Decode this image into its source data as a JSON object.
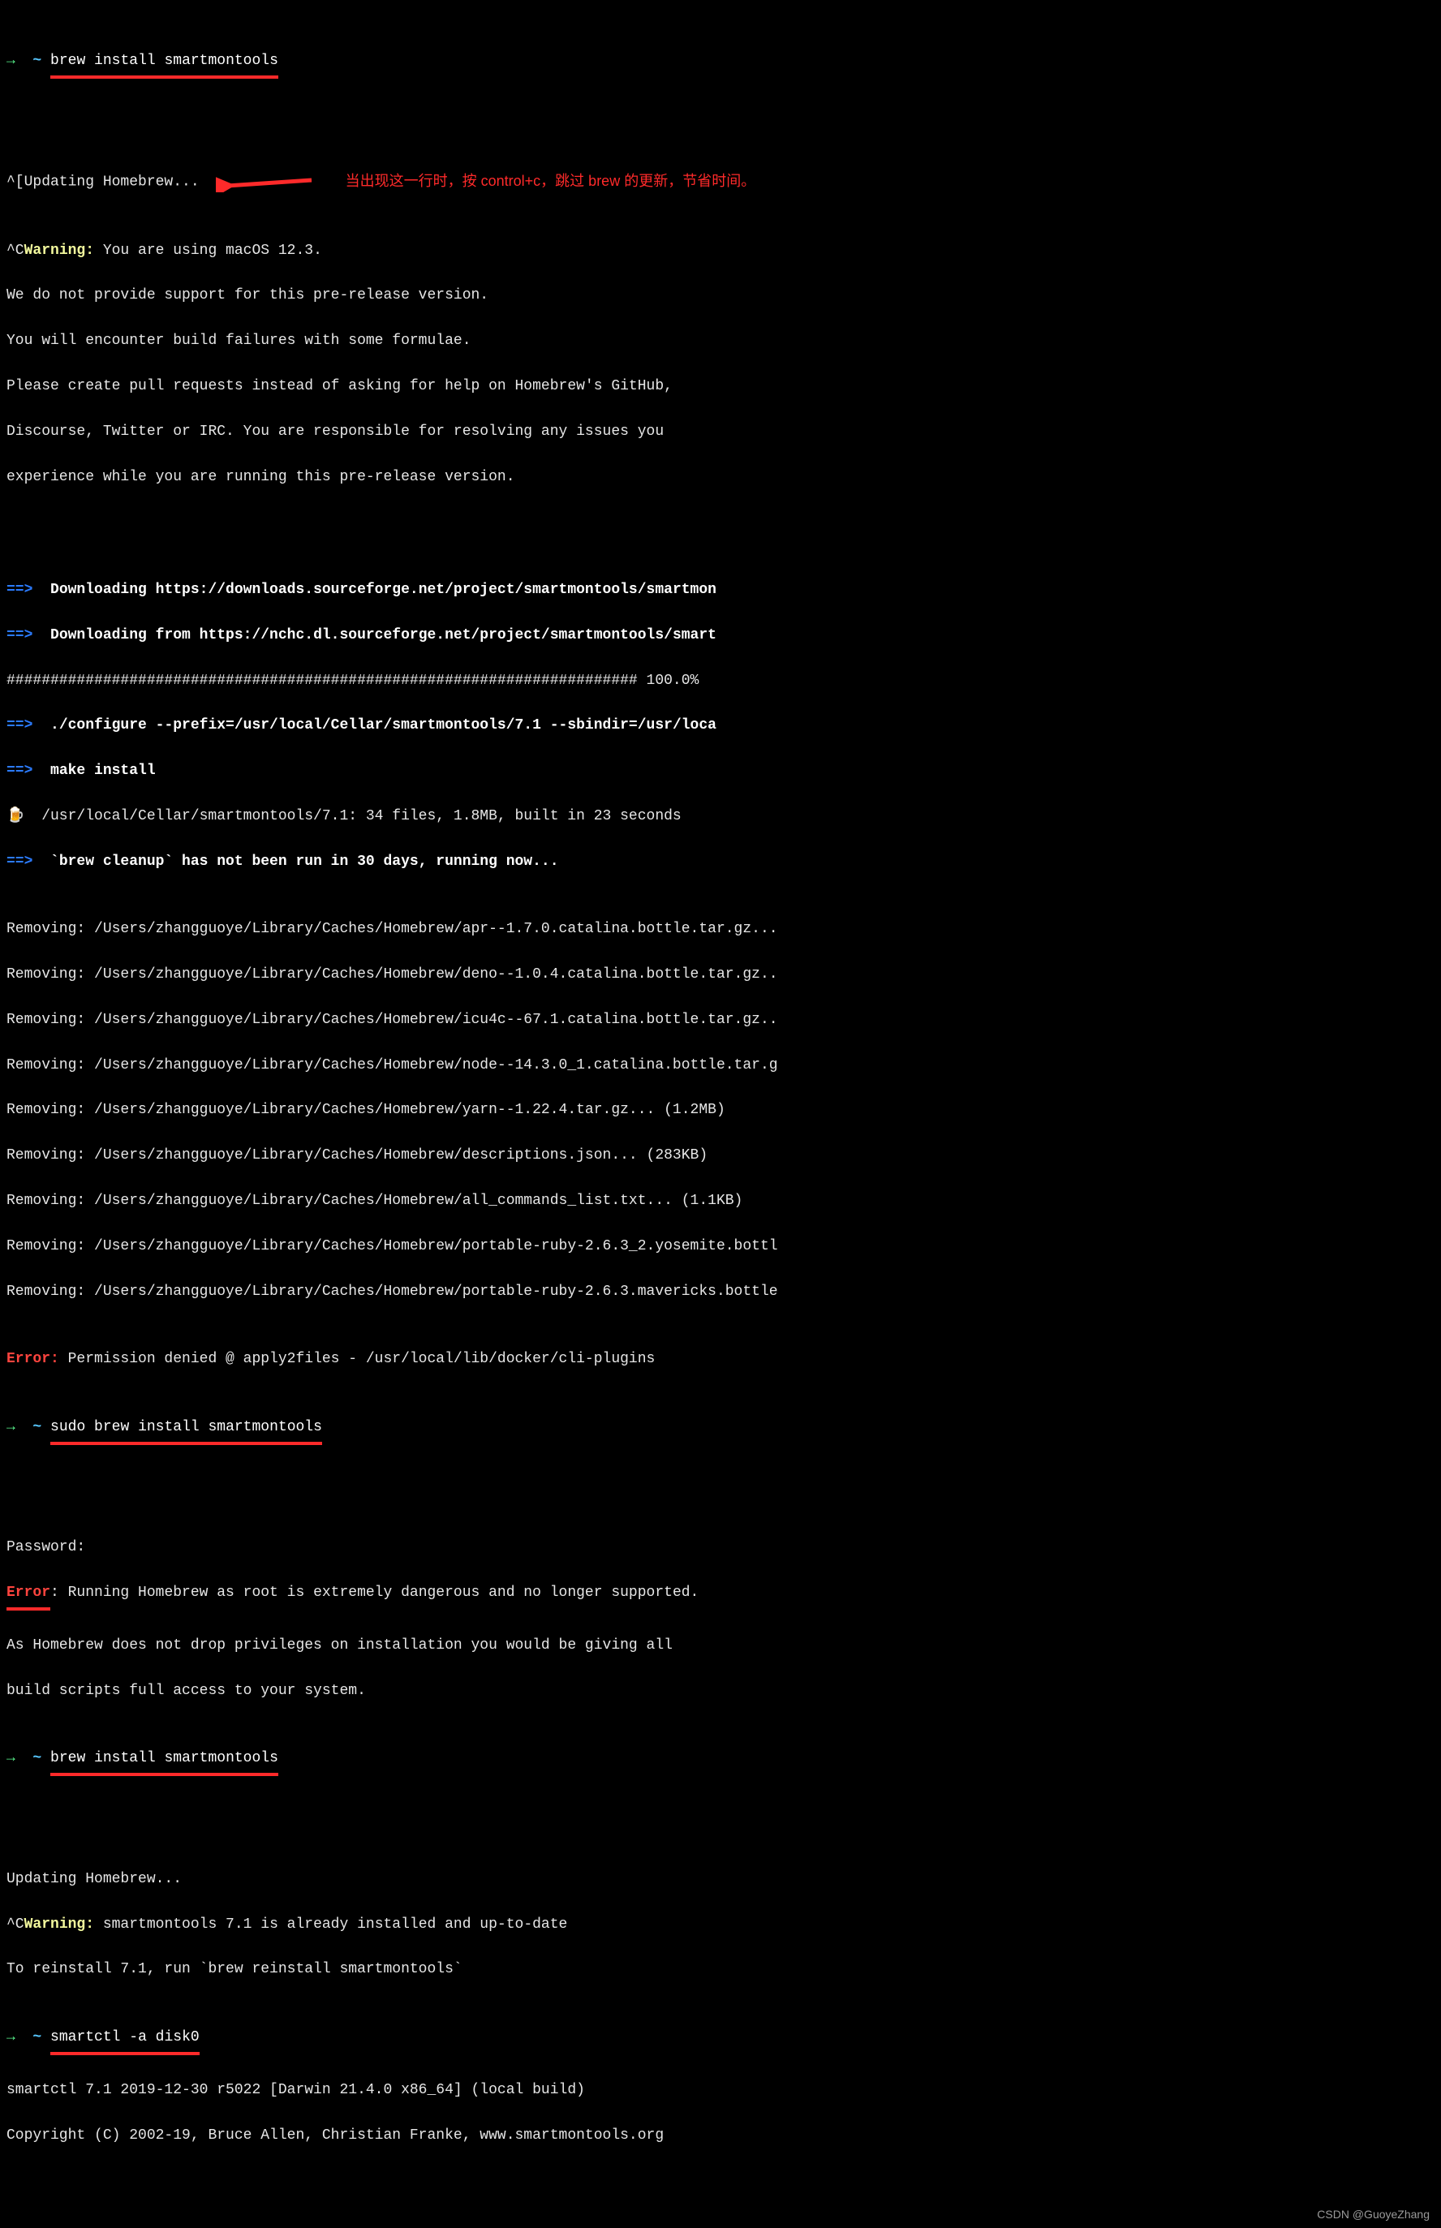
{
  "colors": {
    "green": "#5af78e",
    "cyan": "#57c7ff",
    "yellow": "#f3f99d",
    "blue": "#2b7bff",
    "red": "#ff443e"
  },
  "annotation": {
    "text": "当出现这一行时，按 control+c，跳过 brew 的更新，节省时间。"
  },
  "prompts": {
    "arrow": "→",
    "tilde": "~",
    "cmd1": "brew install smartmontools",
    "cmd2": "sudo brew install smartmontools",
    "cmd3": "brew install smartmontools",
    "cmd4": "smartctl -a disk0"
  },
  "lines": {
    "updating": "^[Updating Homebrew...",
    "warn_prefix": "^C",
    "warn_label": "Warning:",
    "warn_rest": " You are using macOS 12.3.",
    "w1": "We do not provide support for this pre-release version.",
    "w2": "You will encounter build failures with some formulae.",
    "w3": "Please create pull requests instead of asking for help on Homebrew's GitHub,",
    "w4": "Discourse, Twitter or IRC. You are responsible for resolving any issues you",
    "w5": "experience while you are running this pre-release version.",
    "arrow_marker": "==>",
    "dl1": "Downloading https://downloads.sourceforge.net/project/smartmontools/smartmon",
    "dl2": "Downloading from https://nchc.dl.sourceforge.net/project/smartmontools/smart",
    "progress": "######################################################################## 100.0%",
    "cfg": "./configure --prefix=/usr/local/Cellar/smartmontools/7.1 --sbindir=/usr/loca",
    "make": "make install",
    "beer": "🍺",
    "built": "/usr/local/Cellar/smartmontools/7.1: 34 files, 1.8MB, built in 23 seconds",
    "cleanup": "`brew cleanup` has not been run in 30 days, running now...",
    "rm1": "Removing: /Users/zhangguoye/Library/Caches/Homebrew/apr--1.7.0.catalina.bottle.tar.gz...",
    "rm2": "Removing: /Users/zhangguoye/Library/Caches/Homebrew/deno--1.0.4.catalina.bottle.tar.gz..",
    "rm3": "Removing: /Users/zhangguoye/Library/Caches/Homebrew/icu4c--67.1.catalina.bottle.tar.gz..",
    "rm4": "Removing: /Users/zhangguoye/Library/Caches/Homebrew/node--14.3.0_1.catalina.bottle.tar.g",
    "rm5": "Removing: /Users/zhangguoye/Library/Caches/Homebrew/yarn--1.22.4.tar.gz... (1.2MB)",
    "rm6": "Removing: /Users/zhangguoye/Library/Caches/Homebrew/descriptions.json... (283KB)",
    "rm7": "Removing: /Users/zhangguoye/Library/Caches/Homebrew/all_commands_list.txt... (1.1KB)",
    "rm8": "Removing: /Users/zhangguoye/Library/Caches/Homebrew/portable-ruby-2.6.3_2.yosemite.bottl",
    "rm9": "Removing: /Users/zhangguoye/Library/Caches/Homebrew/portable-ruby-2.6.3.mavericks.bottle",
    "err1_label": "Error:",
    "err1_rest": " Permission denied @ apply2files - /usr/local/lib/docker/cli-plugins",
    "password": "Password:",
    "err2_label": "Error",
    "err2_rest": ": Running Homebrew as root is extremely dangerous and no longer supported.",
    "er1": "As Homebrew does not drop privileges on installation you would be giving all",
    "er2": "build scripts full access to your system.",
    "updating2": "Updating Homebrew...",
    "warn2_rest": " smartmontools 7.1 is already installed and up-to-date",
    "reinstall": "To reinstall 7.1, run `brew reinstall smartmontools`",
    "sc1": "smartctl 7.1 2019-12-30 r5022 [Darwin 21.4.0 x86_64] (local build)",
    "sc2": "Copyright (C) 2002-19, Bruce Allen, Christian Franke, www.smartmontools.org"
  },
  "watermark": "CSDN @GuoyeZhang"
}
